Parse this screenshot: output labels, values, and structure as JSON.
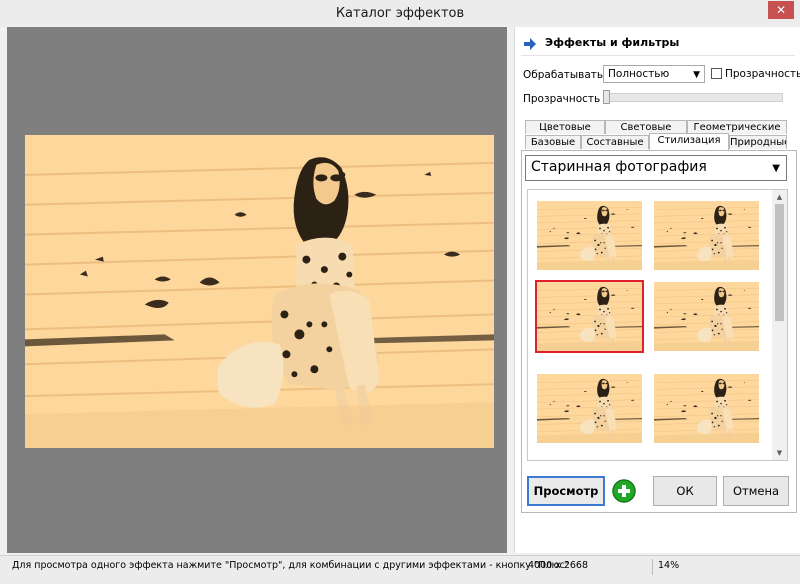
{
  "window": {
    "title": "Каталог эффектов",
    "close_symbol": "✕"
  },
  "panel": {
    "title": "Эффекты и фильтры",
    "process_label": "Обрабатывать",
    "process_value": "Полностью",
    "transparency_checkbox_label": "Прозрачность",
    "transparency_slider_label": "Прозрачность",
    "transparency_value": 0
  },
  "tabs": {
    "row_top": [
      "Цветовые",
      "Световые",
      "Геометрические"
    ],
    "row_bottom": [
      "Базовые",
      "Составные",
      "Стилизация",
      "Природные"
    ],
    "active": "Стилизация"
  },
  "effect": {
    "selected": "Старинная фотография",
    "selected_thumbnail_index": 2,
    "thumbnail_count": 6
  },
  "buttons": {
    "preview": "Просмотр",
    "ok": "ОК",
    "cancel": "Отмена"
  },
  "status": {
    "hint": "Для просмотра одного эффекта нажмите \"Просмотр\", для комбинации с другими эффектами - кнопку \"Плюс\"",
    "dimensions": "4000 x 2668",
    "zoom": "14%"
  },
  "colors": {
    "sepia_light": "#fdd79c",
    "sepia_dark": "#2b2115",
    "preview_bg": "#7f7f7f",
    "accent": "#3d7bd0",
    "selection": "#e0202a",
    "plus_green": "#21a828"
  }
}
